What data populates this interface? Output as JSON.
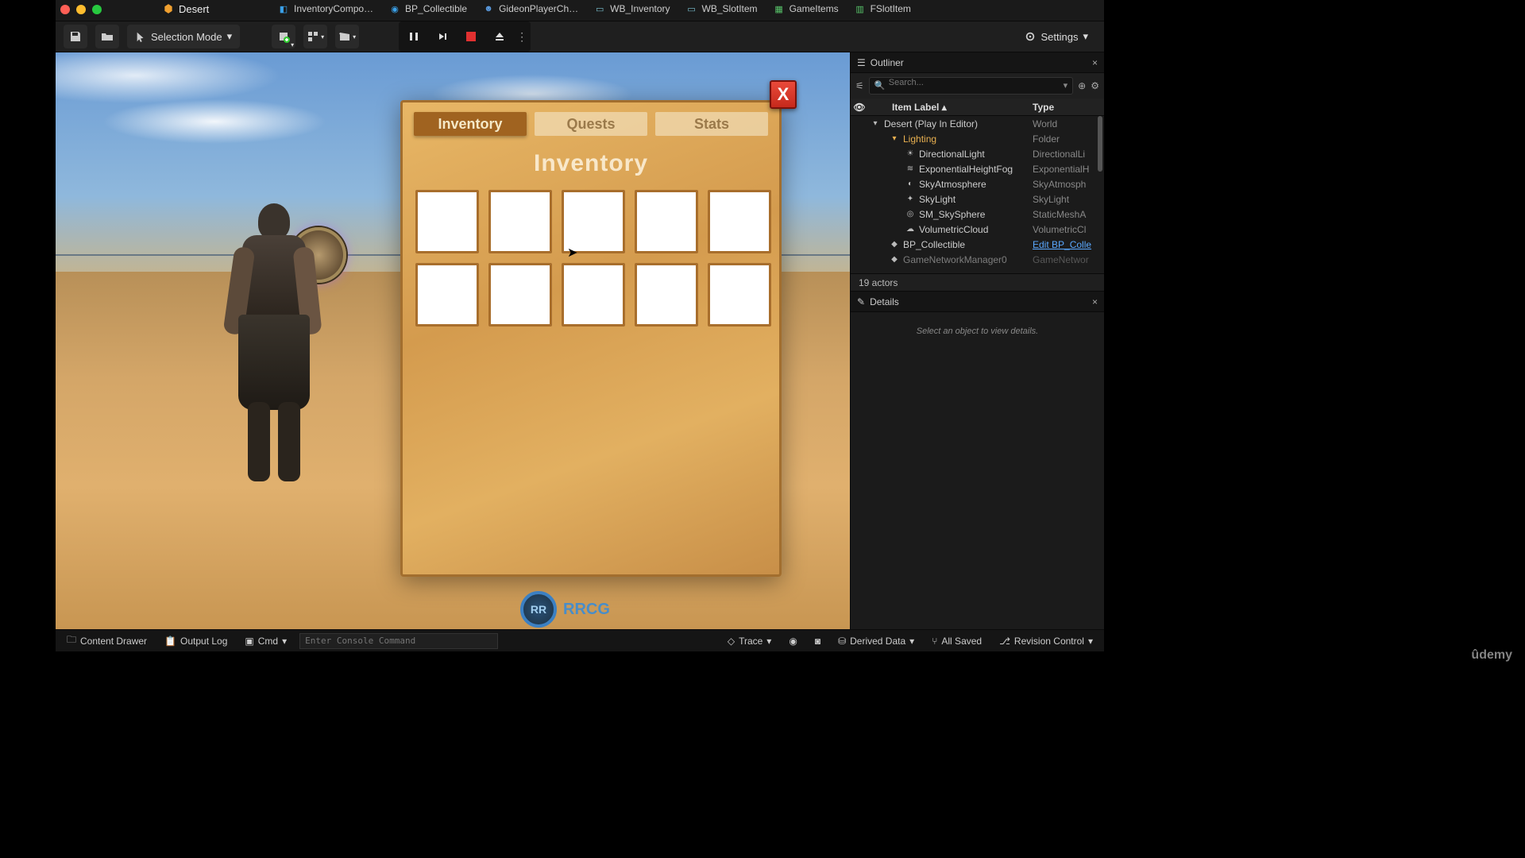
{
  "app": {
    "title": "Desert"
  },
  "tabs": [
    {
      "label": "InventoryCompo…",
      "color": "#3aa0e8"
    },
    {
      "label": "BP_Collectible",
      "color": "#3aa0e8"
    },
    {
      "label": "GideonPlayerCh…",
      "color": "#5a9be0"
    },
    {
      "label": "WB_Inventory",
      "color": "#7ac0d0"
    },
    {
      "label": "WB_SlotItem",
      "color": "#7ac0d0"
    },
    {
      "label": "GameItems",
      "color": "#58c46a"
    },
    {
      "label": "FSlotItem",
      "color": "#58c46a"
    }
  ],
  "toolbar": {
    "selection_mode": "Selection Mode",
    "settings": "Settings"
  },
  "inventory": {
    "close": "X",
    "tabs": [
      "Inventory",
      "Quests",
      "Stats"
    ],
    "active_tab": 0,
    "title": "Inventory",
    "slot_count": 10
  },
  "outliner": {
    "title": "Outliner",
    "search_placeholder": "Search...",
    "columns": {
      "label": "Item Label",
      "type": "Type"
    },
    "rows": [
      {
        "indent": 1,
        "icon": "▾",
        "label": "Desert (Play In Editor)",
        "type": "World"
      },
      {
        "indent": 2,
        "icon": "▾",
        "label": "Lighting",
        "type": "Folder",
        "folder": true
      },
      {
        "indent": 3,
        "icon": "☀",
        "label": "DirectionalLight",
        "type": "DirectionalLi"
      },
      {
        "indent": 3,
        "icon": "≋",
        "label": "ExponentialHeightFog",
        "type": "ExponentialH"
      },
      {
        "indent": 3,
        "icon": "◐",
        "label": "SkyAtmosphere",
        "type": "SkyAtmosph"
      },
      {
        "indent": 3,
        "icon": "✦",
        "label": "SkyLight",
        "type": "SkyLight"
      },
      {
        "indent": 3,
        "icon": "◎",
        "label": "SM_SkySphere",
        "type": "StaticMeshA"
      },
      {
        "indent": 3,
        "icon": "☁",
        "label": "VolumetricCloud",
        "type": "VolumetricCl"
      },
      {
        "indent": 2,
        "icon": "◆",
        "label": "BP_Collectible",
        "type": "Edit BP_Colle",
        "link": true
      },
      {
        "indent": 2,
        "icon": "◆",
        "label": "GameNetworkManager0",
        "type": "GameNetwor",
        "dim": true
      }
    ],
    "actor_count": "19 actors"
  },
  "details": {
    "title": "Details",
    "empty": "Select an object to view details."
  },
  "bottombar": {
    "content_drawer": "Content Drawer",
    "output_log": "Output Log",
    "cmd_label": "Cmd",
    "console_placeholder": "Enter Console Command",
    "trace": "Trace",
    "derived_data": "Derived Data",
    "all_saved": "All Saved",
    "revision_control": "Revision Control"
  },
  "watermark": {
    "circle": "RR",
    "text": "RRCG"
  },
  "udemy": "ûdemy"
}
